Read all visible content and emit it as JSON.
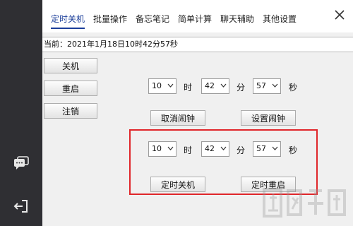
{
  "sidebar": {
    "icons": [
      "chat-icon",
      "logout-icon"
    ]
  },
  "tabs": [
    {
      "label": "定时关机",
      "active": true
    },
    {
      "label": "批量操作",
      "active": false
    },
    {
      "label": "备忘笔记",
      "active": false
    },
    {
      "label": "简单计算",
      "active": false
    },
    {
      "label": "聊天辅助",
      "active": false
    },
    {
      "label": "其他设置",
      "active": false
    }
  ],
  "current_time": "当前：2021年1月18日10时42分57秒",
  "quick_actions": {
    "shutdown": "关机",
    "restart": "重启",
    "logoff": "注销"
  },
  "alarm": {
    "hour": "10",
    "minute": "42",
    "second": "57",
    "cancel_label": "取消闹钟",
    "set_label": "设置闹钟"
  },
  "timer": {
    "hour": "10",
    "minute": "42",
    "second": "57",
    "shutdown_label": "定时关机",
    "restart_label": "定时重启"
  },
  "units": {
    "hour": "时",
    "minute": "分",
    "second": "秒"
  },
  "colors": {
    "sidebar": "#2f2f33",
    "accent": "#1a3d99",
    "highlight": "#e0262a"
  }
}
